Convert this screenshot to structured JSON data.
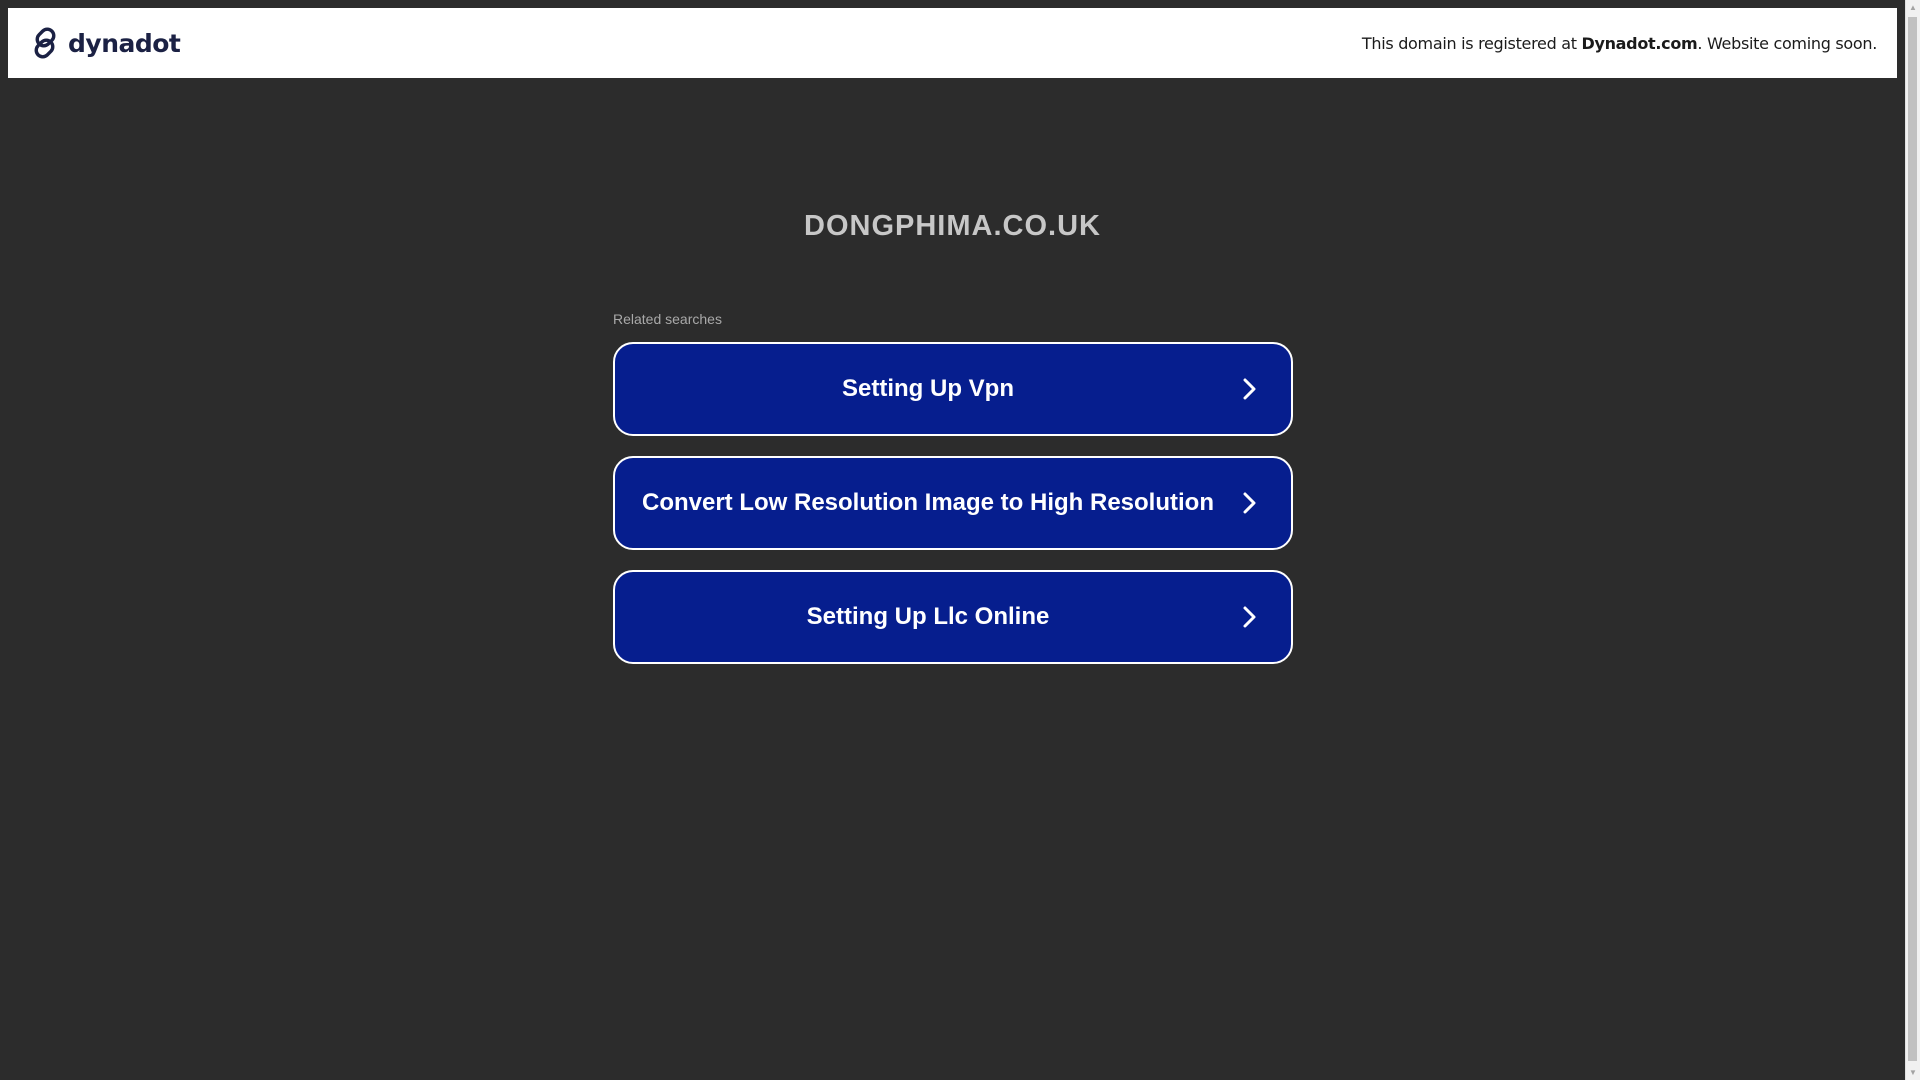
{
  "header": {
    "logo_text": "dynadot",
    "notice_prefix": "This domain is registered at ",
    "notice_brand": "Dynadot.com",
    "notice_suffix": ". Website coming soon."
  },
  "main": {
    "domain": "DONGPHIMA.CO.UK",
    "related_label": "Related searches",
    "links": [
      {
        "label": "Setting Up Vpn"
      },
      {
        "label": "Convert Low Resolution Image to High Resolution"
      },
      {
        "label": "Setting Up Llc Online"
      }
    ]
  },
  "colors": {
    "page_background": "#2c2c2c",
    "header_background": "#ffffff",
    "link_button": "#061e8e",
    "logo_text": "#1b2144",
    "domain_title": "#c7c7c7"
  },
  "icons": {
    "logo": "dynadot-link-icon",
    "link_arrow": "chevron-right-icon"
  }
}
